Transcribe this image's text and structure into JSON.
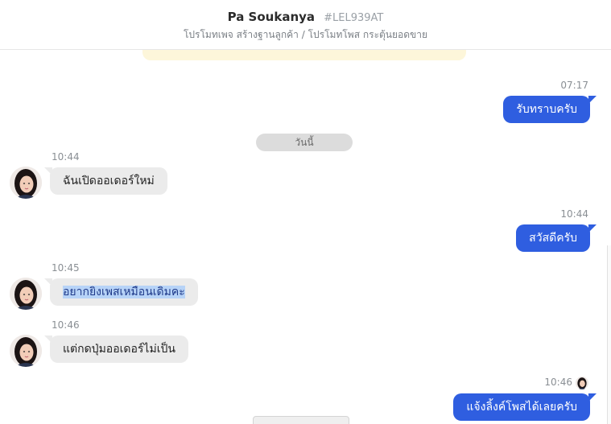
{
  "header": {
    "contact_name": "Pa Soukanya",
    "contact_code": "#LEL939AT",
    "subtitle": "โปรโมทเพจ สร้างฐานลูกค้า / โปรโมทโพส กระตุ้นยอดขาย"
  },
  "date_separator": "วันนี้",
  "messages": [
    {
      "direction": "out",
      "time": "07:17",
      "text": "รับทราบครับ"
    },
    {
      "direction": "in",
      "time": "10:44",
      "text": "ฉันเปิดออเดอร์ใหม่"
    },
    {
      "direction": "out",
      "time": "10:44",
      "text": "สวัสดีครับ"
    },
    {
      "direction": "in",
      "time": "10:45",
      "text": "อยากยิงเพสเหมือนเดิมคะ",
      "selected": true
    },
    {
      "direction": "in",
      "time": "10:46",
      "text": "แต่กดปุ่มออเดอร์ไม่เป็น"
    },
    {
      "direction": "out",
      "time": "10:46",
      "text": "แจ้งลิ้งค์โพสได้เลยครับ",
      "read_avatar": true
    }
  ],
  "colors": {
    "outgoing_bubble": "#2f5ee0",
    "incoming_bubble": "#ebebeb",
    "notice_strip": "#fdf6da",
    "selection": "#b7d3f7"
  },
  "icons": {
    "contact_avatar": "user-avatar-photo",
    "read_receipt": "read-receipt-avatar"
  }
}
